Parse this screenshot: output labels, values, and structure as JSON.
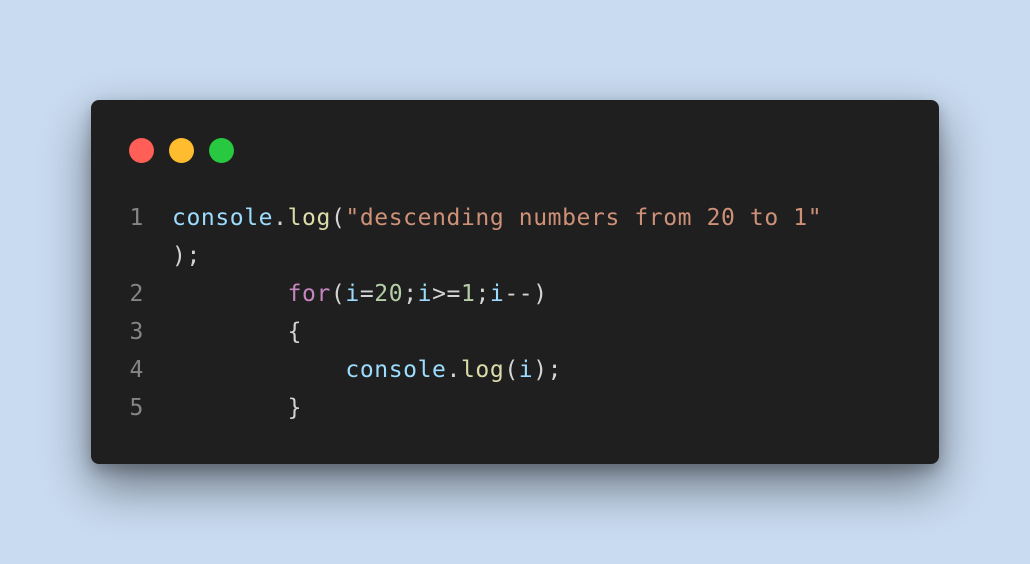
{
  "window": {
    "buttons": [
      "close",
      "minimize",
      "zoom"
    ]
  },
  "code": {
    "lines": [
      {
        "number": "1",
        "tokens": [
          {
            "text": "console",
            "kind": "var"
          },
          {
            "text": ".",
            "kind": "punc"
          },
          {
            "text": "log",
            "kind": "fn"
          },
          {
            "text": "(",
            "kind": "punc"
          },
          {
            "text": "\"descending numbers from 20 to 1\"",
            "kind": "str"
          }
        ]
      },
      {
        "number": "",
        "tokens": [
          {
            "text": ");",
            "kind": "punc"
          }
        ]
      },
      {
        "number": "2",
        "tokens": [
          {
            "text": "        ",
            "kind": "punc"
          },
          {
            "text": "for",
            "kind": "kw"
          },
          {
            "text": "(",
            "kind": "punc"
          },
          {
            "text": "i",
            "kind": "var"
          },
          {
            "text": "=",
            "kind": "punc"
          },
          {
            "text": "20",
            "kind": "num"
          },
          {
            "text": ";",
            "kind": "punc"
          },
          {
            "text": "i",
            "kind": "var"
          },
          {
            "text": ">=",
            "kind": "punc"
          },
          {
            "text": "1",
            "kind": "num"
          },
          {
            "text": ";",
            "kind": "punc"
          },
          {
            "text": "i",
            "kind": "var"
          },
          {
            "text": "--)",
            "kind": "punc"
          }
        ]
      },
      {
        "number": "3",
        "tokens": [
          {
            "text": "        {",
            "kind": "punc"
          }
        ]
      },
      {
        "number": "4",
        "tokens": [
          {
            "text": "            ",
            "kind": "punc"
          },
          {
            "text": "console",
            "kind": "var"
          },
          {
            "text": ".",
            "kind": "punc"
          },
          {
            "text": "log",
            "kind": "fn"
          },
          {
            "text": "(",
            "kind": "punc"
          },
          {
            "text": "i",
            "kind": "var"
          },
          {
            "text": ");",
            "kind": "punc"
          }
        ]
      },
      {
        "number": "5",
        "tokens": [
          {
            "text": "        }",
            "kind": "punc"
          }
        ]
      }
    ]
  },
  "colors": {
    "page_background": "#c9dbf1",
    "window_background": "#1f1f1f",
    "line_number": "#858585",
    "variable": "#9cdcfe",
    "function": "#dcdcaa",
    "string": "#ce9178",
    "keyword": "#c586c0",
    "number": "#b5cea8",
    "punctuation": "#d4d4d4",
    "close": "#ff5f57",
    "minimize": "#febc2e",
    "zoom": "#28c840"
  }
}
